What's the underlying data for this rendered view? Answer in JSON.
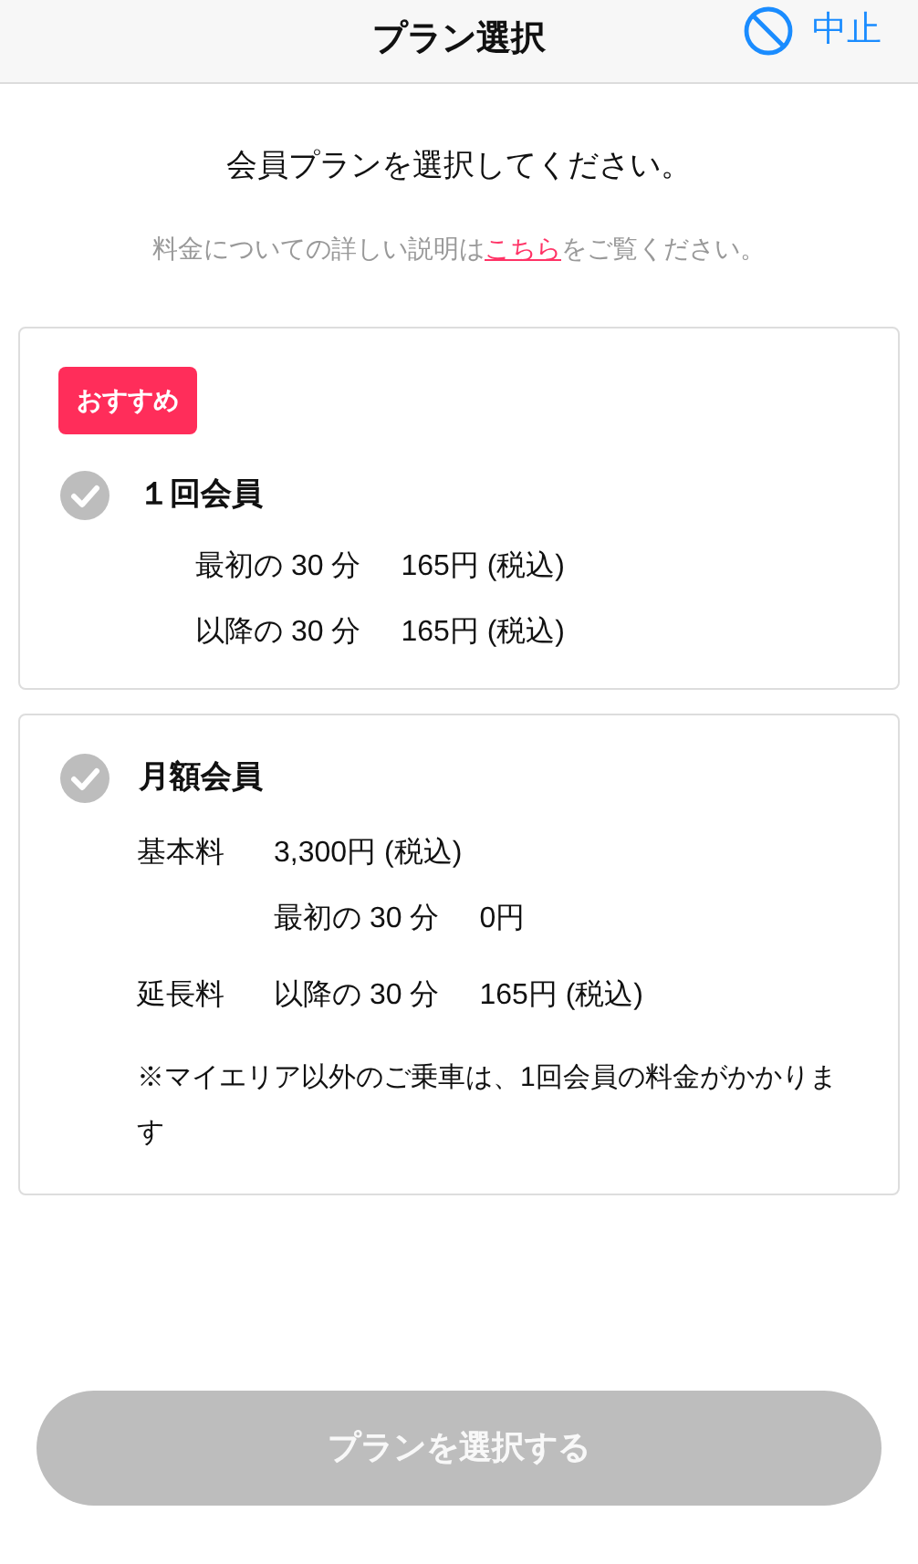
{
  "header": {
    "title": "プラン選択",
    "cancel": "中止"
  },
  "instruction": "会員プランを選択してください。",
  "info": {
    "before": "料金についての詳しい説明は",
    "link": "こちら",
    "after": "をご覧ください。"
  },
  "plans": [
    {
      "kind": "simple",
      "badge": "おすすめ",
      "name": "１回会員",
      "selected": false,
      "rows": [
        {
          "cells": [
            "最初の 30 分",
            "165円 (税込)"
          ]
        },
        {
          "cells": [
            "以降の 30 分",
            "165円 (税込)"
          ]
        }
      ]
    },
    {
      "kind": "labeled",
      "name": "月額会員",
      "selected": false,
      "rows": [
        {
          "label": "基本料",
          "cells": [
            "3,300円 (税込)"
          ]
        },
        {
          "cells": [
            "最初の 30 分",
            "0円"
          ]
        },
        {
          "label": "延長料",
          "cells": [
            "以降の 30 分",
            "165円 (税込)"
          ]
        }
      ],
      "note": "※マイエリア以外のご乗車は、1回会員の料金がかかります"
    }
  ],
  "submit": {
    "label": "プランを選択する",
    "disabled": true
  }
}
